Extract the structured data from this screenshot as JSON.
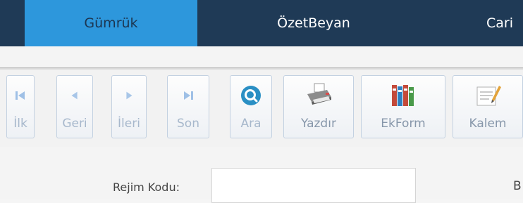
{
  "tabs": [
    {
      "label": "Gümrük",
      "active": true
    },
    {
      "label": "ÖzetBeyan",
      "active": false
    },
    {
      "label": "Cari",
      "active": false
    }
  ],
  "toolbar": {
    "buttons": [
      {
        "label": "İlk",
        "icon": "first-icon"
      },
      {
        "label": "Geri",
        "icon": "previous-icon"
      },
      {
        "label": "İleri",
        "icon": "next-icon"
      },
      {
        "label": "Son",
        "icon": "last-icon"
      },
      {
        "label": "Ara",
        "icon": "search-icon"
      },
      {
        "label": "Yazdır",
        "icon": "printer-icon"
      },
      {
        "label": "EkForm",
        "icon": "binders-icon"
      },
      {
        "label": "Kalem",
        "icon": "notepad-icon"
      }
    ]
  },
  "form": {
    "rejim_kodu_label": "Rejim Kodu:",
    "rejim_kodu_value": "",
    "right_partial_label": "B"
  },
  "colors": {
    "topbar_bg": "#1f3a56",
    "active_tab_bg": "#2d97dc",
    "toolbar_bg": "#f2f2f2"
  }
}
